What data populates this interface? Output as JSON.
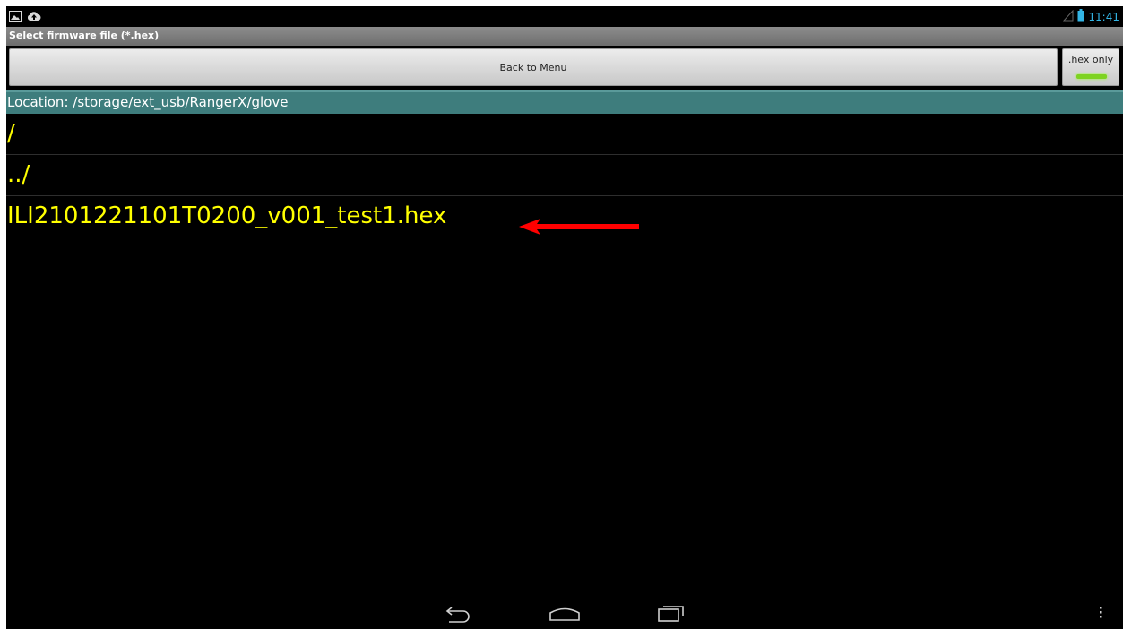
{
  "status_bar": {
    "left_icons": [
      "image-icon",
      "cloud-upload-icon"
    ],
    "right_icons": [
      "signal-icon",
      "battery-icon"
    ],
    "time": "11:41"
  },
  "title": "Select firmware file (*.hex)",
  "toolbar": {
    "back_label": "Back to Menu",
    "hex_toggle_label": ".hex only",
    "hex_toggle_on": true
  },
  "location": {
    "text": "Location: /storage/ext_usb/RangerX/glove"
  },
  "files": [
    {
      "name": "/"
    },
    {
      "name": "../"
    },
    {
      "name": "ILI2101221101T0200_v001_test1.hex"
    }
  ],
  "annotation": {
    "arrow_color": "#ff0000"
  },
  "nav_bar": {
    "buttons": [
      "back-icon",
      "home-icon",
      "recent-apps-icon",
      "menu-overflow-icon"
    ]
  },
  "colors": {
    "file_text": "#ffff00",
    "location_bg": "#3e7d7d",
    "status_accent": "#33b5e5",
    "toggle_on": "#7ed321"
  }
}
